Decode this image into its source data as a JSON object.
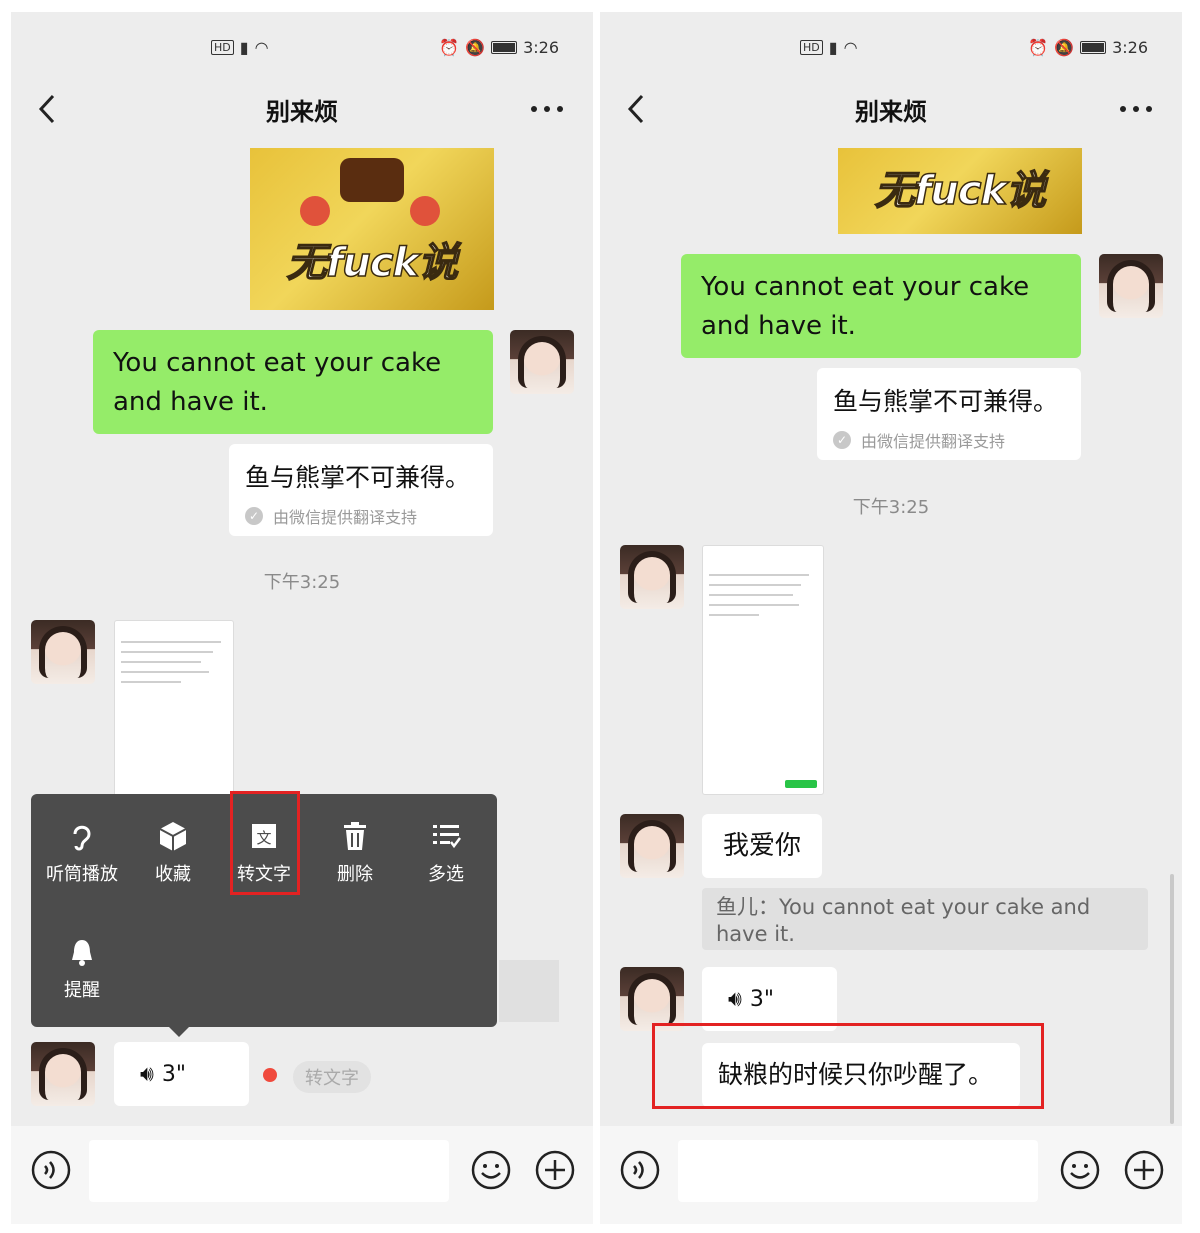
{
  "screens": [
    {
      "status": {
        "time": "3:26",
        "network": "HD"
      },
      "title": "别来烦",
      "sticker_caption": "无fuck说",
      "sent_message": "You cannot eat your cake and have it.",
      "translation": {
        "text": "鱼与熊掌不可兼得。",
        "credit": "由微信提供翻译支持"
      },
      "timestamp": "下午3:25",
      "menu": {
        "items": [
          "听筒播放",
          "收藏",
          "转文字",
          "删除",
          "多选",
          "提醒"
        ]
      },
      "voice_duration": "3\"",
      "voice_to_text_label": "转文字"
    },
    {
      "status": {
        "time": "3:26",
        "network": "HD"
      },
      "title": "别来烦",
      "sticker_caption": "无fuck说",
      "sent_message": "You cannot eat your cake and have it.",
      "translation": {
        "text": "鱼与熊掌不可兼得。",
        "credit": "由微信提供翻译支持"
      },
      "timestamp": "下午3:25",
      "reply_text": "我爱你",
      "quote": "鱼儿：You cannot eat your cake and have it.",
      "voice_duration": "3\"",
      "voice_transcript": "缺粮的时候只你吵醒了。"
    }
  ],
  "colors": {
    "green_bubble": "#95ec69",
    "highlight": "#e32222",
    "menu_bg": "#4c4c4c"
  }
}
